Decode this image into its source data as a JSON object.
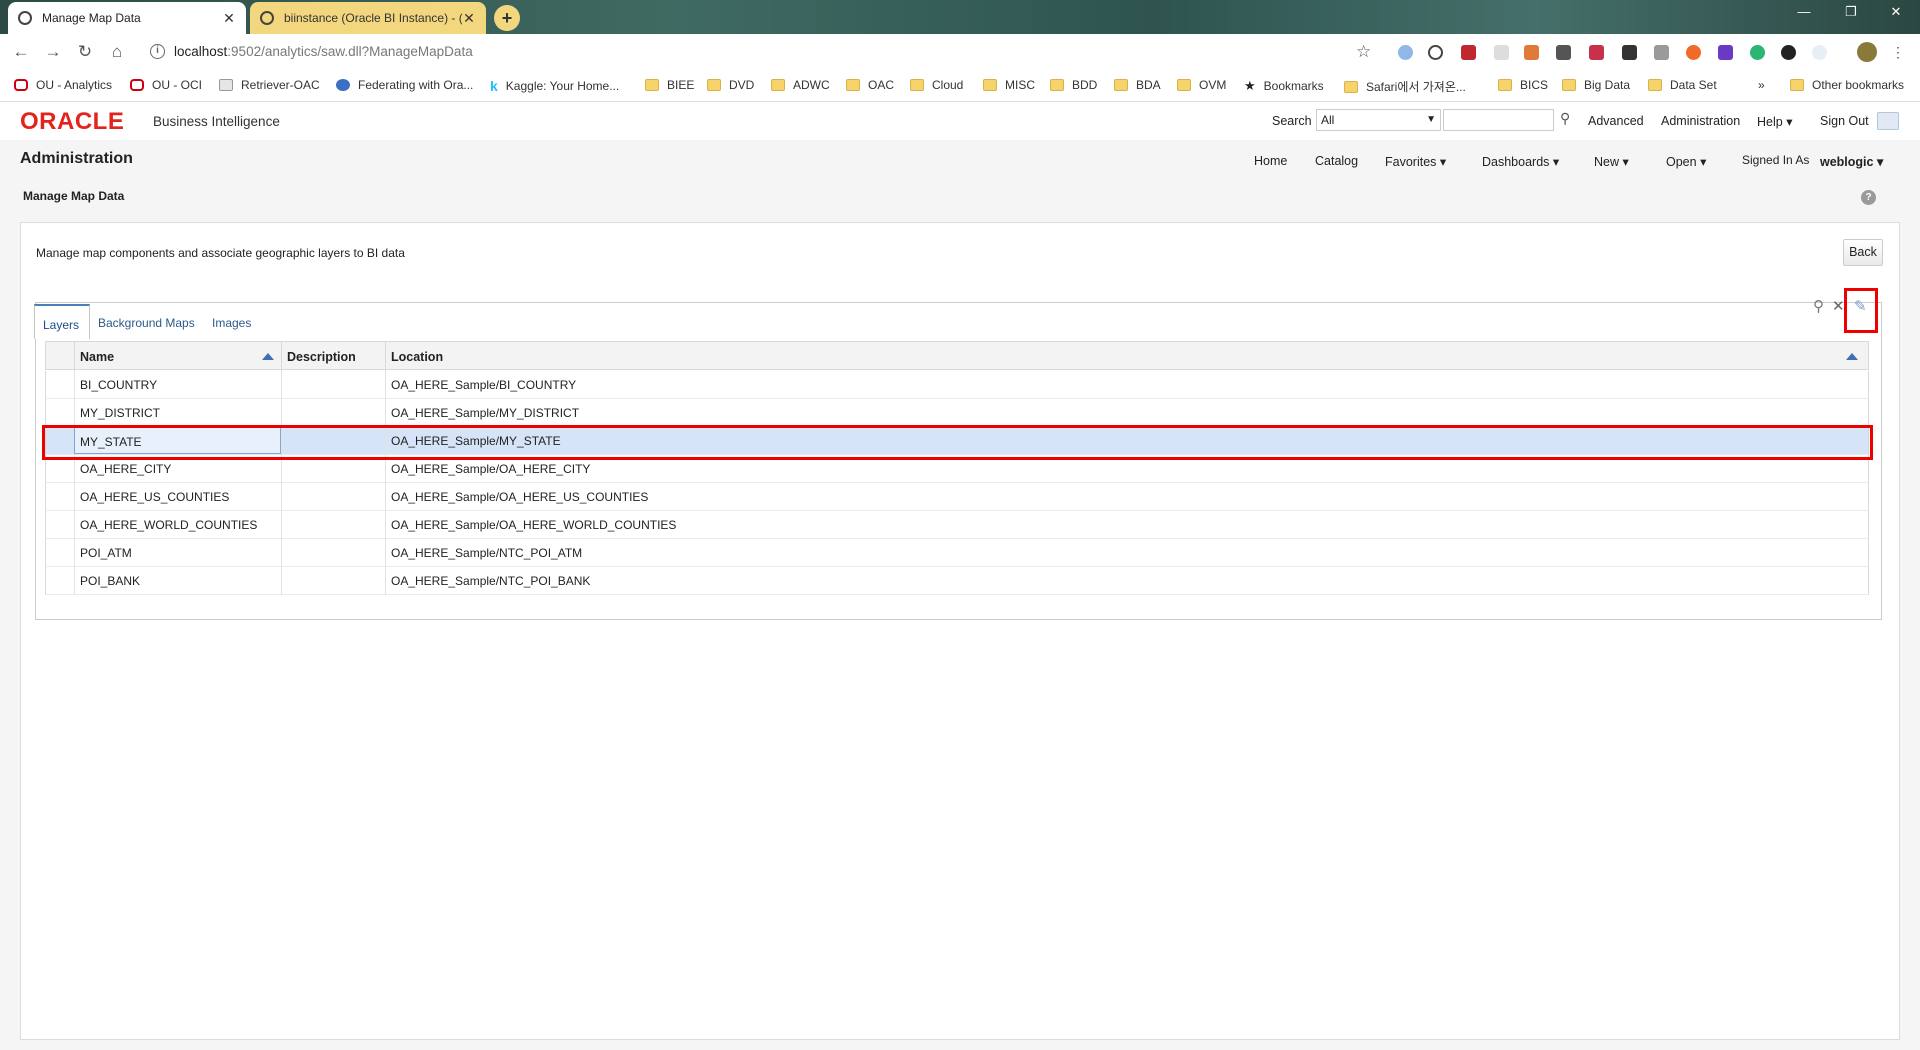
{
  "browser": {
    "tabs": [
      {
        "title": "Manage Map Data",
        "close": "✕"
      },
      {
        "title": "biinstance (Oracle BI Instance) - (",
        "close": "✕"
      }
    ],
    "new_tab": "+",
    "window_controls": [
      "—",
      "❐",
      "✕"
    ],
    "url_host": "localhost",
    "url_path": ":9502/analytics/saw.dll?ManageMapData",
    "bookmarks": [
      {
        "label": "OU - Analytics",
        "icon": "oracle"
      },
      {
        "label": "OU - OCI",
        "icon": "oracle"
      },
      {
        "label": "Retriever-OAC",
        "icon": "page"
      },
      {
        "label": "Federating with Ora...",
        "icon": "blue"
      },
      {
        "label": "Kaggle: Your Home...",
        "icon": "k"
      },
      {
        "label": "BIEE",
        "icon": "folder"
      },
      {
        "label": "DVD",
        "icon": "folder"
      },
      {
        "label": "ADWC",
        "icon": "folder"
      },
      {
        "label": "OAC",
        "icon": "folder"
      },
      {
        "label": "Cloud",
        "icon": "folder"
      },
      {
        "label": "MISC",
        "icon": "folder"
      },
      {
        "label": "BDD",
        "icon": "folder"
      },
      {
        "label": "BDA",
        "icon": "folder"
      },
      {
        "label": "OVM",
        "icon": "folder"
      },
      {
        "label": "Bookmarks",
        "icon": "star"
      },
      {
        "label": "Safari에서 가져온...",
        "icon": "folder"
      },
      {
        "label": "BICS",
        "icon": "folder"
      },
      {
        "label": "Big Data",
        "icon": "folder"
      },
      {
        "label": "Data Set",
        "icon": "folder"
      }
    ],
    "more_bookmarks": "»",
    "other_bookmarks": "Other bookmarks"
  },
  "bi_header": {
    "logo": "ORACLE",
    "product": "Business Intelligence",
    "search_label": "Search",
    "search_scope": "All",
    "advanced": "Advanced",
    "administration": "Administration",
    "help": "Help",
    "sign_out": "Sign Out"
  },
  "page": {
    "title": "Administration",
    "nav": {
      "home": "Home",
      "catalog": "Catalog",
      "favorites": "Favorites",
      "dashboards": "Dashboards",
      "new": "New",
      "open": "Open",
      "signed_in_as": "Signed In As",
      "user": "weblogic"
    },
    "section_title": "Manage Map Data",
    "description": "Manage map components and associate geographic layers to BI data",
    "back": "Back",
    "tabs": [
      "Layers",
      "Background Maps",
      "Images"
    ],
    "columns": [
      "Name",
      "Description",
      "Location"
    ],
    "rows": [
      {
        "name": "BI_COUNTRY",
        "description": "",
        "location": "OA_HERE_Sample/BI_COUNTRY"
      },
      {
        "name": "MY_DISTRICT",
        "description": "",
        "location": "OA_HERE_Sample/MY_DISTRICT"
      },
      {
        "name": "MY_STATE",
        "description": "",
        "location": "OA_HERE_Sample/MY_STATE",
        "selected": true
      },
      {
        "name": "OA_HERE_CITY",
        "description": "",
        "location": "OA_HERE_Sample/OA_HERE_CITY"
      },
      {
        "name": "OA_HERE_US_COUNTIES",
        "description": "",
        "location": "OA_HERE_Sample/OA_HERE_US_COUNTIES"
      },
      {
        "name": "OA_HERE_WORLD_COUNTIES",
        "description": "",
        "location": "OA_HERE_Sample/OA_HERE_WORLD_COUNTIES"
      },
      {
        "name": "POI_ATM",
        "description": "",
        "location": "OA_HERE_Sample/NTC_POI_ATM"
      },
      {
        "name": "POI_BANK",
        "description": "",
        "location": "OA_HERE_Sample/NTC_POI_BANK"
      }
    ]
  },
  "colors": {
    "oracle_red": "#e3231e",
    "selected_row": "#d5e4f7",
    "highlight": "#ee0000",
    "tab_accent": "#4a7fb8"
  }
}
